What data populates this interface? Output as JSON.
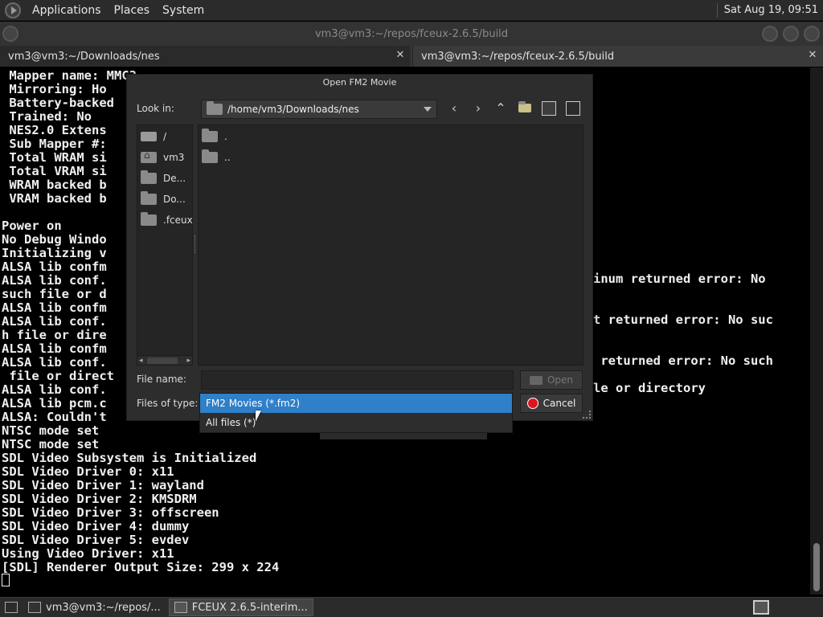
{
  "top_panel": {
    "menus": [
      "Applications",
      "Places",
      "System"
    ],
    "clock": "Sat Aug 19, 09:51"
  },
  "terminal_window": {
    "title": "vm3@vm3:~/repos/fceux-2.6.5/build",
    "tabs": [
      {
        "label": "vm3@vm3:~/Downloads/nes"
      },
      {
        "label": "vm3@vm3:~/repos/fceux-2.6.5/build"
      }
    ],
    "visible_lines_left": [
      " Mapper name: MMC3",
      " Mirroring: Ho",
      " Battery-backed",
      " Trained: No",
      " NES2.0 Extens",
      " Sub Mapper #:",
      " Total WRAM si",
      " Total VRAM si",
      " WRAM backed b",
      " VRAM backed b",
      "",
      "Power on",
      "No Debug Windo",
      "Initializing v",
      "ALSA lib confm",
      "ALSA lib conf.",
      "such file or d",
      "ALSA lib confm",
      "ALSA lib conf.",
      "h file or dire",
      "ALSA lib confm",
      "ALSA lib conf.",
      " file or direct",
      "ALSA lib conf.",
      "ALSA lib pcm.c",
      "ALSA: Couldn't",
      "NTSC mode set",
      "NTSC mode set",
      "SDL Video Subsystem is Initialized",
      "SDL Video Driver 0: x11",
      "SDL Video Driver 1: wayland",
      "SDL Video Driver 2: KMSDRM",
      "SDL Video Driver 3: offscreen",
      "SDL Video Driver 4: dummy",
      "SDL Video Driver 5: evdev",
      "Using Video Driver: x11",
      "[SDL] Renderer Output Size: 299 x 224"
    ],
    "visible_fragments_right": [
      "inum returned error: No",
      "t returned error: No suc",
      " returned error: No such",
      "le or directory"
    ]
  },
  "dialog": {
    "title": "Open FM2 Movie",
    "look_in_label": "Look in:",
    "look_in_path": "/home/vm3/Downloads/nes",
    "sidebar_items": [
      "/",
      "vm3",
      "De...",
      "Do...",
      ".fceux"
    ],
    "files": [
      ".",
      ".."
    ],
    "file_name_label": "File name:",
    "file_name_value": "",
    "files_of_type_label": "Files of type:",
    "open_label": "Open",
    "cancel_label": "Cancel",
    "type_options": [
      "FM2 Movies (*.fm2)",
      "All files (*)"
    ],
    "selected_type": "FM2 Movies (*.fm2)"
  },
  "taskbar": {
    "tasks": [
      {
        "label": "vm3@vm3:~/repos/...",
        "active": false
      },
      {
        "label": "FCEUX 2.6.5-interim...",
        "active": true
      }
    ]
  },
  "colors": {
    "panel_bg": "#2b2b2b",
    "dialog_bg": "#2d2d2d",
    "selection": "#2f7fc9",
    "cancel_red": "#e0141e",
    "terminal_bg": "#000000"
  }
}
